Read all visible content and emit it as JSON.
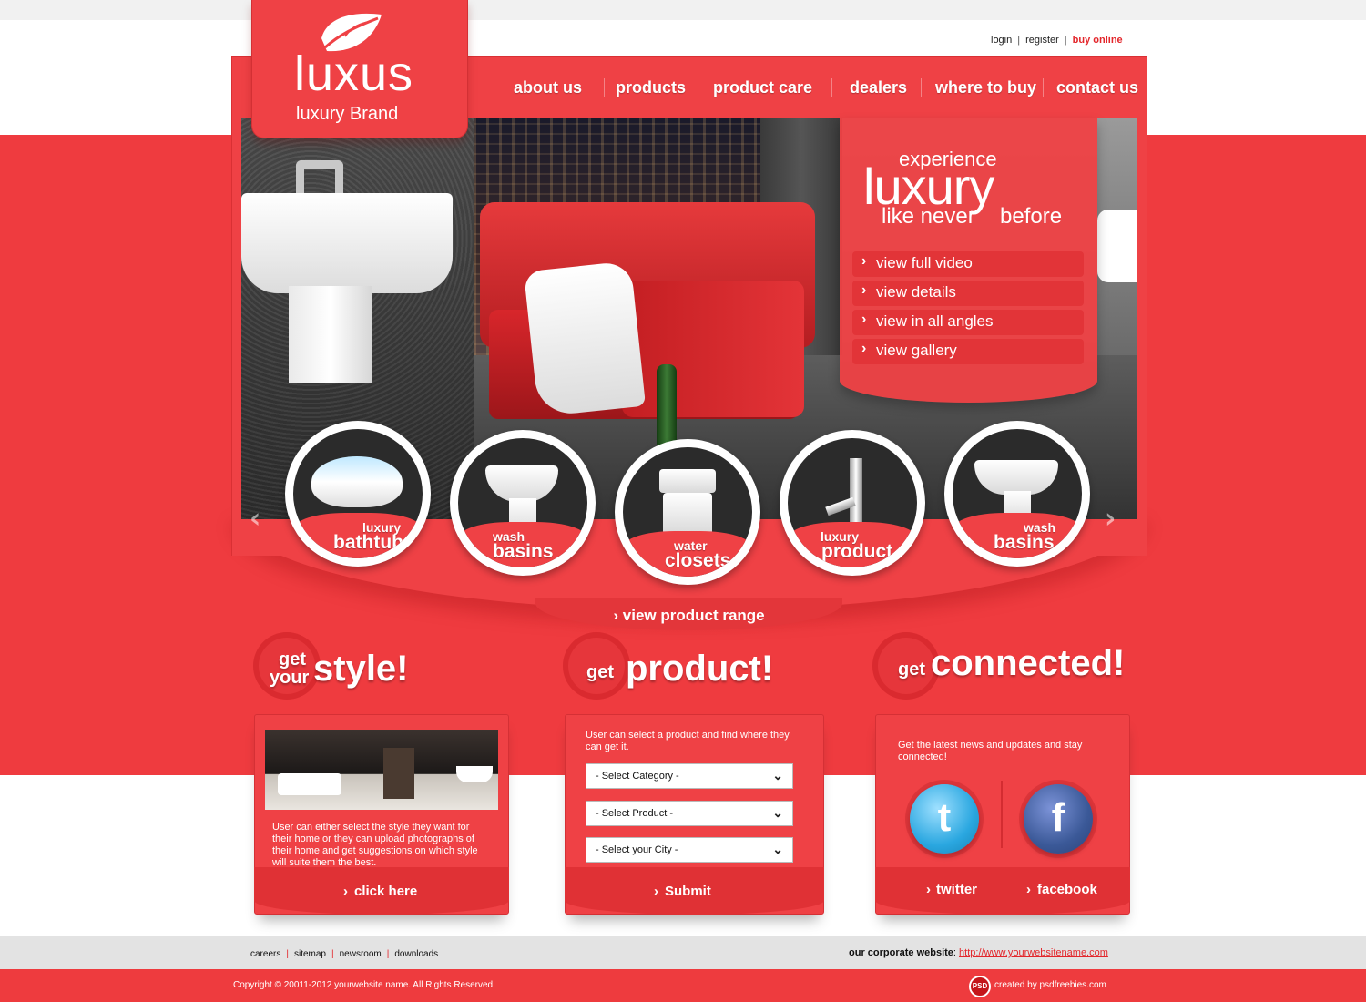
{
  "top_links": {
    "login": "login",
    "register": "register",
    "buy_online": "buy online",
    "separator": "|"
  },
  "logo": {
    "name": "luxus",
    "tagline": "luxury Brand"
  },
  "nav": [
    {
      "label": "about us"
    },
    {
      "label": "products"
    },
    {
      "label": "product care"
    },
    {
      "label": "dealers"
    },
    {
      "label": "where to buy"
    },
    {
      "label": "contact us"
    }
  ],
  "promo": {
    "line1": "experience",
    "line2": "luxury",
    "line3": "like never",
    "line4": "before",
    "buttons": [
      "view full video",
      "view details",
      "view in all angles",
      "view gallery"
    ]
  },
  "carousel": [
    {
      "small": "luxury",
      "big": "bathtub"
    },
    {
      "small": "wash",
      "big": "basins"
    },
    {
      "small": "water",
      "big": "closets"
    },
    {
      "small": "luxury",
      "big": "product"
    },
    {
      "small": "wash",
      "big": "basins"
    }
  ],
  "view_range": "view product range",
  "style_section": {
    "title_small_1": "get",
    "title_small_2": "your",
    "title_big": "style!",
    "text": "User can either select the style they want for their home or they can upload photographs of their home and get suggestions on which style will suite them the best.",
    "button": "click here"
  },
  "product_section": {
    "title_small": "get",
    "title_big": "product!",
    "text": "User can select a product and find where they can get it.",
    "select_category": "- Select Category -",
    "select_product": "- Select Product -",
    "select_city": "- Select your City -",
    "button": "Submit"
  },
  "connected_section": {
    "title_small": "get",
    "title_big": "connected!",
    "text": "Get the latest news and updates and stay connected!",
    "twitter_label": "twitter",
    "facebook_label": "facebook",
    "twitter_glyph": "t",
    "facebook_glyph": "f"
  },
  "footer": {
    "links": [
      "careers",
      "sitemap",
      "newsroom",
      "downloads"
    ],
    "corporate_label": "our corporate website",
    "corporate_url": "http://www.yourwebsitename.com",
    "copyright": "Copyright © 20011-2012 yourwebsite name. All Rights Reserved",
    "psd_badge": "PSD",
    "credit": "created by psdfreebies.com"
  },
  "colors": {
    "brand_red": "#ef4145",
    "dark_red": "#e03135",
    "link_red": "#e3262b"
  },
  "icons": [
    "leaf-logo-icon",
    "chevron-right-icon",
    "chevron-down-icon",
    "arrow-left-icon",
    "arrow-right-icon",
    "twitter-icon",
    "facebook-icon"
  ]
}
